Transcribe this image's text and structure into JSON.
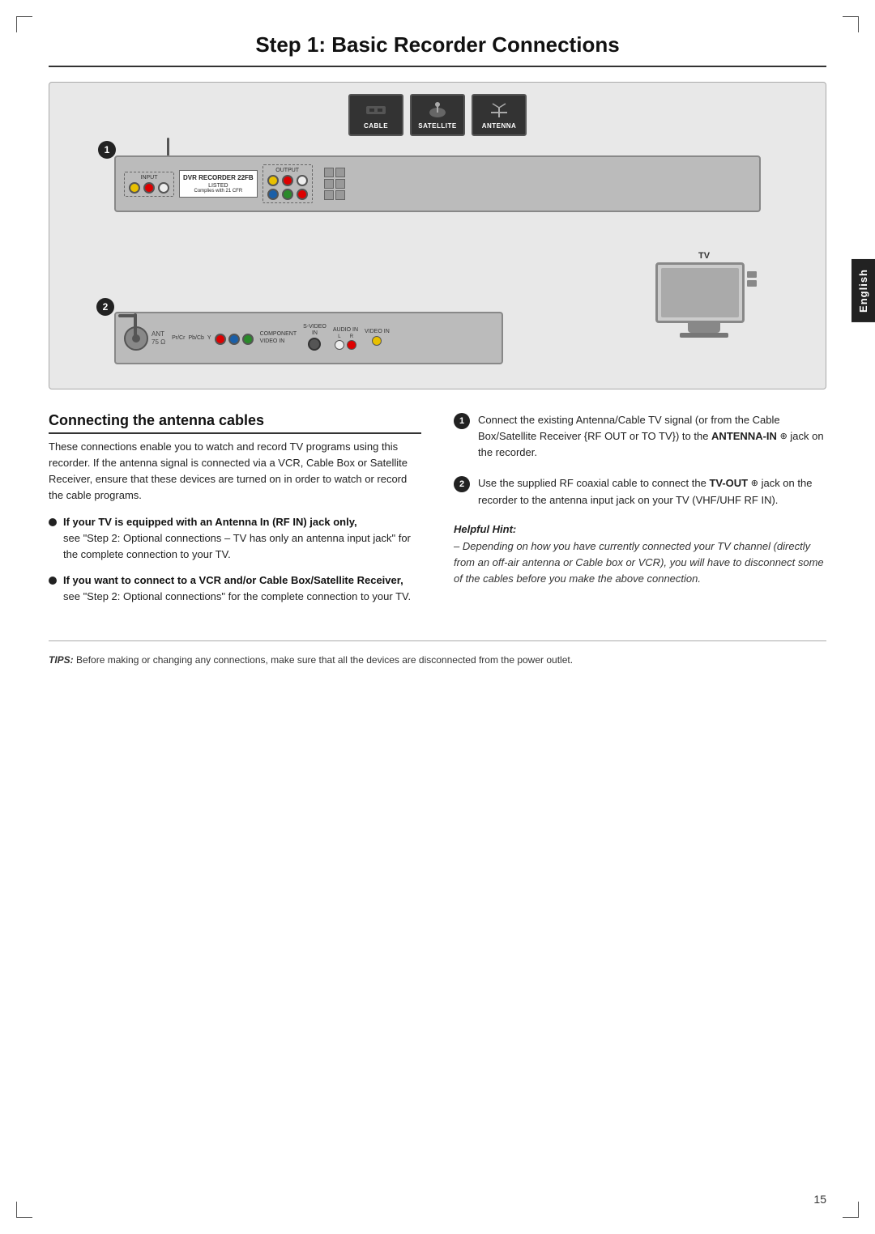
{
  "page": {
    "title": "Step 1: Basic Recorder Connections",
    "number": "15",
    "language_tab": "English"
  },
  "diagram": {
    "icons": [
      {
        "label": "CABLE",
        "shape": "cable"
      },
      {
        "label": "SATELLITE",
        "shape": "satellite"
      },
      {
        "label": "ANTENNA",
        "shape": "antenna"
      }
    ],
    "step_badges": [
      "❶",
      "❷"
    ],
    "tv_label": "TV"
  },
  "section": {
    "title": "Connecting the antenna cables",
    "intro": "These connections enable you to watch and record TV programs using this recorder. If the antenna signal is connected via a VCR, Cable Box or Satellite Receiver, ensure that these devices are turned on in order to watch or record the cable programs.",
    "bullets": [
      {
        "title": "If your TV is equipped with an Antenna In (RF IN) jack only,",
        "text": "see \"Step 2: Optional connections – TV has only an antenna input jack\" for the complete connection to your TV."
      },
      {
        "title": "If you want to connect to a VCR and/or Cable Box/Satellite Receiver,",
        "text": "see \"Step 2: Optional connections\" for the complete connection to your TV."
      }
    ]
  },
  "steps": [
    {
      "num": "1",
      "text": "Connect the existing Antenna/Cable TV signal (or from the Cable Box/Satellite Receiver {RF OUT or TO TV}) to the ",
      "bold": "ANTENNA-IN",
      "connector": "⊕",
      "text2": " jack on the recorder."
    },
    {
      "num": "2",
      "text": "Use the supplied RF coaxial cable to connect the ",
      "bold": "TV-OUT",
      "connector": "⊕",
      "text2": " jack on the recorder to the antenna input jack on your TV (VHF/UHF RF IN)."
    }
  ],
  "helpful_hint": {
    "title": "Helpful Hint:",
    "text": "– Depending on how you have currently connected your TV channel (directly from an off-air antenna or Cable box or VCR), you will have to disconnect some of the cables before you make the above connection."
  },
  "tips": {
    "label": "TIPS:",
    "text": "Before making or changing any connections, make sure that all the devices are disconnected from the power outlet."
  }
}
